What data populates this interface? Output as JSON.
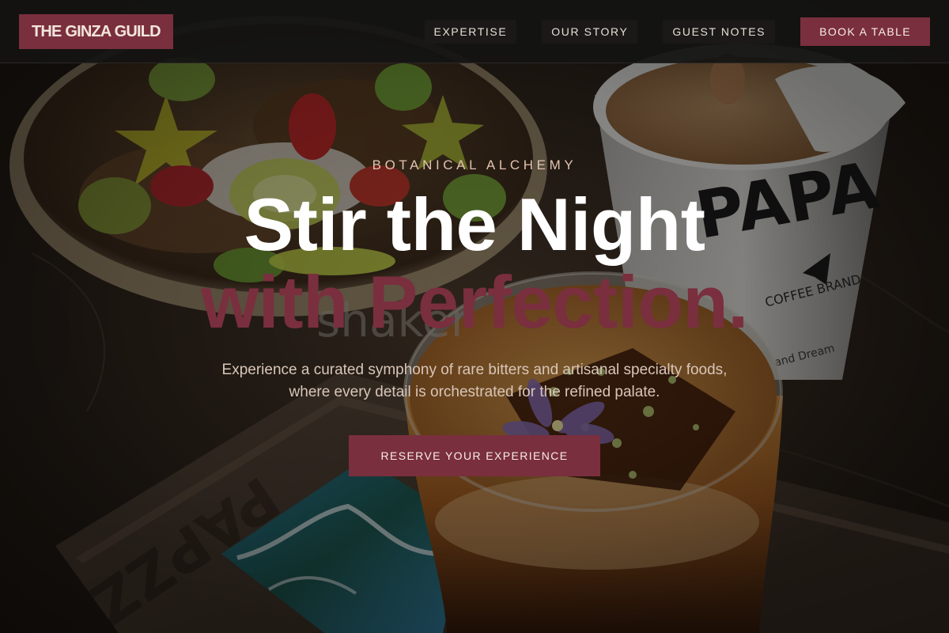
{
  "header": {
    "brand": "THE GINZA GUILD",
    "nav": [
      {
        "label": "EXPERTISE"
      },
      {
        "label": "OUR STORY"
      },
      {
        "label": "GUEST NOTES"
      }
    ],
    "cta_label": "BOOK A TABLE"
  },
  "hero": {
    "eyebrow": "BOTANICAL ALCHEMY",
    "title_line1": "Stir the Night",
    "title_line2": "with Perfection.",
    "description": "Experience a curated symphony of rare bitters and artisanal specialty foods, where every detail is orchestrated for the refined palate.",
    "cta_label": "RESERVE YOUR EXPERIENCE",
    "background_alt": "Craft cocktail with edible flowers beside a fruit and granola bowl and a coffee cup on a dark wooden table"
  },
  "colors": {
    "accent": "#7a2f3e",
    "header_bg": "#141312",
    "headline": "#ffffff",
    "eyebrow": "#e3c2b1",
    "body_text": "#d9c6b8"
  }
}
